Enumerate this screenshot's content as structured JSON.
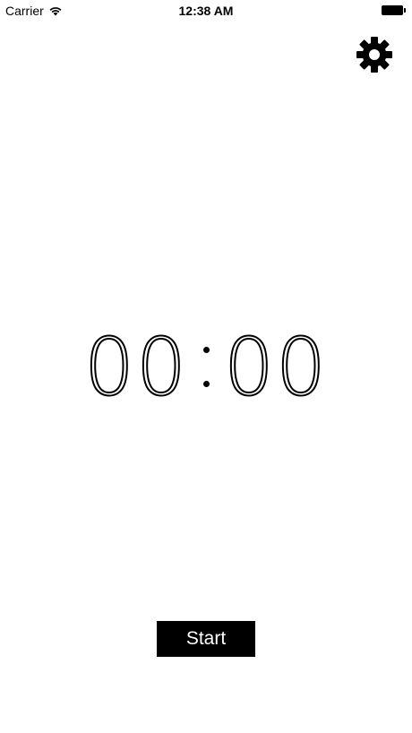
{
  "status_bar": {
    "carrier": "Carrier",
    "time": "12:38 AM"
  },
  "icons": {
    "wifi": "wifi-icon",
    "battery": "battery-icon",
    "settings": "gear-icon"
  },
  "timer": {
    "minutes": "00",
    "seconds": "00"
  },
  "controls": {
    "start_label": "Start"
  },
  "colors": {
    "background": "#ffffff",
    "foreground": "#000000"
  }
}
